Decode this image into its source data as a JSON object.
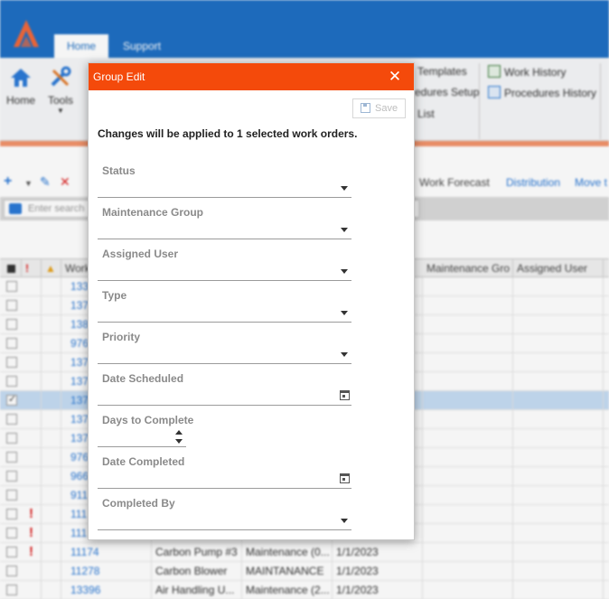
{
  "app": {
    "tabs": [
      "Home",
      "Support"
    ],
    "ribbon": {
      "home_label": "Home",
      "tools_label": "Tools",
      "templates_label": "Templates",
      "procedures_setup_label": "edures Setup",
      "list_label": "List",
      "work_history_label": "Work History",
      "procedures_history_label": "Procedures History"
    },
    "toolbar": {
      "work_forecast": "Work Forecast",
      "distribution": "Distribution",
      "move_to": "Move t"
    },
    "search": {
      "placeholder": "Enter search"
    },
    "grid": {
      "headers": [
        "Work",
        "Maintenance Gro",
        "Assigned User"
      ],
      "rows": [
        {
          "wo": "133",
          "asset": "",
          "group": "",
          "date": "",
          "checked": false,
          "warn": false
        },
        {
          "wo": "137",
          "asset": "",
          "group": "",
          "date": "",
          "checked": false,
          "warn": false
        },
        {
          "wo": "138",
          "asset": "",
          "group": "",
          "date": "",
          "checked": false,
          "warn": false
        },
        {
          "wo": "976",
          "asset": "",
          "group": "",
          "date": "",
          "checked": false,
          "warn": false
        },
        {
          "wo": "137",
          "asset": "",
          "group": "",
          "date": "",
          "checked": false,
          "warn": false
        },
        {
          "wo": "137",
          "asset": "",
          "group": "",
          "date": "",
          "checked": false,
          "warn": false
        },
        {
          "wo": "137",
          "asset": "",
          "group": "",
          "date": "",
          "checked": true,
          "warn": false
        },
        {
          "wo": "137",
          "asset": "",
          "group": "",
          "date": "",
          "checked": false,
          "warn": false
        },
        {
          "wo": "137",
          "asset": "",
          "group": "",
          "date": "",
          "checked": false,
          "warn": false
        },
        {
          "wo": "976",
          "asset": "",
          "group": "",
          "date": "",
          "checked": false,
          "warn": false
        },
        {
          "wo": "966",
          "asset": "",
          "group": "",
          "date": "",
          "checked": false,
          "warn": false
        },
        {
          "wo": "911",
          "asset": "",
          "group": "",
          "date": "",
          "checked": false,
          "warn": false
        },
        {
          "wo": "111",
          "asset": "",
          "group": "",
          "date": "",
          "checked": false,
          "warn": true
        },
        {
          "wo": "111",
          "asset": "",
          "group": "",
          "date": "",
          "checked": false,
          "warn": true
        },
        {
          "wo": "11174",
          "asset": "Carbon Pump #3",
          "group": "Maintenance (0...",
          "date": "1/1/2023",
          "checked": false,
          "warn": true
        },
        {
          "wo": "11278",
          "asset": "Carbon Blower",
          "group": "MAINTANANCE",
          "date": "1/1/2023",
          "checked": false,
          "warn": false
        },
        {
          "wo": "13396",
          "asset": "Air Handling U...",
          "group": "Maintenance (2...",
          "date": "1/1/2023",
          "checked": false,
          "warn": false
        }
      ]
    }
  },
  "dialog": {
    "title": "Group Edit",
    "close_glyph": "✕",
    "save_label": "Save",
    "message": "Changes will be applied to 1 selected work orders.",
    "fields": [
      {
        "label": "Status",
        "kind": "dropdown",
        "value": ""
      },
      {
        "label": "Maintenance Group",
        "kind": "dropdown",
        "value": ""
      },
      {
        "label": "Assigned User",
        "kind": "dropdown",
        "value": ""
      },
      {
        "label": "Type",
        "kind": "dropdown",
        "value": ""
      },
      {
        "label": "Priority",
        "kind": "dropdown",
        "value": ""
      },
      {
        "label": "Date Scheduled",
        "kind": "date",
        "value": ""
      },
      {
        "label": "Days to Complete",
        "kind": "spin",
        "value": ""
      },
      {
        "label": "Date Completed",
        "kind": "date",
        "value": ""
      },
      {
        "label": "Completed By",
        "kind": "dropdown",
        "value": ""
      }
    ]
  },
  "colors": {
    "brand_blue": "#1f6fc3",
    "dialog_header": "#f44a0b",
    "link": "#2b79d6"
  }
}
